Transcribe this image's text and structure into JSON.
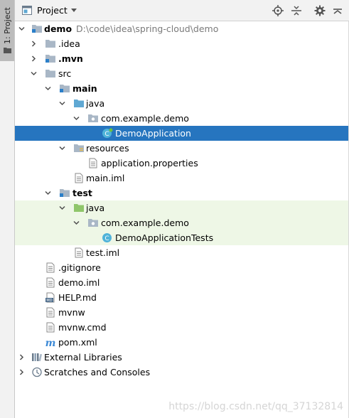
{
  "side_tab": {
    "label": "1: Project"
  },
  "header": {
    "title": "Project"
  },
  "tree": {
    "root": {
      "label": "demo",
      "path": "D:\\code\\idea\\spring-cloud\\demo"
    },
    "idea": {
      "label": ".idea"
    },
    "mvn": {
      "label": ".mvn"
    },
    "src": {
      "label": "src"
    },
    "main": {
      "label": "main"
    },
    "main_java": {
      "label": "java"
    },
    "main_pkg": {
      "label": "com.example.demo"
    },
    "demo_app": {
      "label": "DemoApplication"
    },
    "resources": {
      "label": "resources"
    },
    "app_props": {
      "label": "application.properties"
    },
    "main_iml": {
      "label": "main.iml"
    },
    "test": {
      "label": "test"
    },
    "test_java": {
      "label": "java"
    },
    "test_pkg": {
      "label": "com.example.demo"
    },
    "demo_tests": {
      "label": "DemoApplicationTests"
    },
    "test_iml": {
      "label": "test.iml"
    },
    "gitignore": {
      "label": ".gitignore"
    },
    "demo_iml": {
      "label": "demo.iml"
    },
    "help": {
      "label": "HELP.md"
    },
    "mvnw": {
      "label": "mvnw"
    },
    "mvnw_cmd": {
      "label": "mvnw.cmd"
    },
    "pom": {
      "label": "pom.xml"
    },
    "ext_libs": {
      "label": "External Libraries"
    },
    "scratches": {
      "label": "Scratches and Consoles"
    }
  },
  "watermark": "https://blog.csdn.net/qq_37132814",
  "colors": {
    "selection": "#2675bf",
    "test_tint": "#eef7e6",
    "folder": "#a9b7c6",
    "source_folder": "#5fa8d3",
    "test_folder": "#8fc66a",
    "class_icon": "#4fb3d9"
  }
}
